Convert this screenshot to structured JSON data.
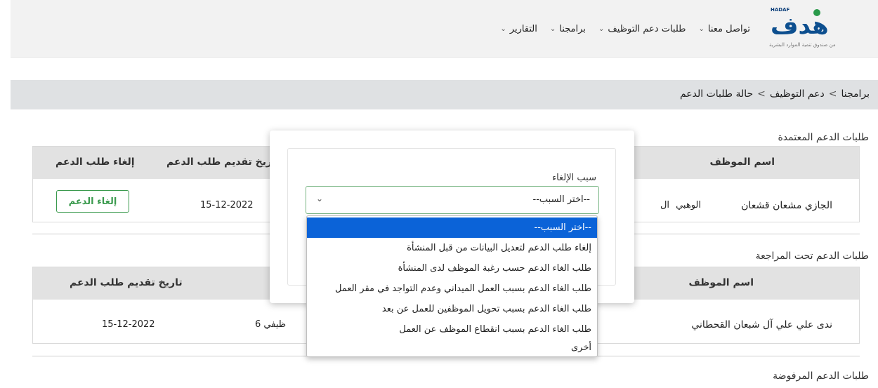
{
  "logo": {
    "small": "HADAF",
    "mark": "هدف",
    "sub": "من صندوق تنمية الموارد البشرية"
  },
  "nav": [
    {
      "label": "تواصل معنا"
    },
    {
      "label": "طلبات دعم التوظيف"
    },
    {
      "label": "برامجنا"
    },
    {
      "label": "التقارير"
    }
  ],
  "breadcrumb": {
    "items": [
      "برامجنا",
      "دعم التوظيف",
      "حالة طلبات الدعم"
    ],
    "sep": ">"
  },
  "approved": {
    "title": "طلبات الدعم المعتمدة",
    "headers": {
      "employee": "اسم الموظف",
      "date": "تاريخ تقديم طلب الدعم",
      "cancel": "إلغاء طلب الدعم"
    },
    "row": {
      "name": "الجازي مشعان قشعان",
      "name2": "الوهبي",
      "extra": "ال",
      "date": "15-12-2022",
      "button": "إلغاء الدعم"
    }
  },
  "review": {
    "title": "طلبات الدعم تحت المراجعة",
    "headers": {
      "employee": "اسم الموظف",
      "date": "تاريخ تقديم طلب الدعم"
    },
    "row": {
      "name": "ندى علي علي آل شبعان القحطاني",
      "program": "ظيفي 6",
      "date": "15-12-2022"
    }
  },
  "rejected": {
    "title": "طلبات الدعم المرفوضة"
  },
  "modal": {
    "label": "سبب الإلغاء",
    "select_value": "--اختر السبب--",
    "options": [
      "--اختر السبب--",
      "إلغاء طلب الدعم لتعديل البيانات من قبل المنشأة",
      "طلب الغاء الدعم حسب رغبة الموظف لدى المنشأة",
      "طلب الغاء الدعم بسبب العمل الميداني وعدم التواجد في مقر العمل",
      "طلب الغاء الدعم بسبب تحويل الموظفين للعمل عن بعد",
      "طلب الغاء الدعم بسبب انقطاع الموظف عن العمل",
      "أخرى"
    ]
  },
  "colors": {
    "accent": "#3b9a4e",
    "selected": "#0b63d8",
    "brand": "#0d4f8f"
  }
}
